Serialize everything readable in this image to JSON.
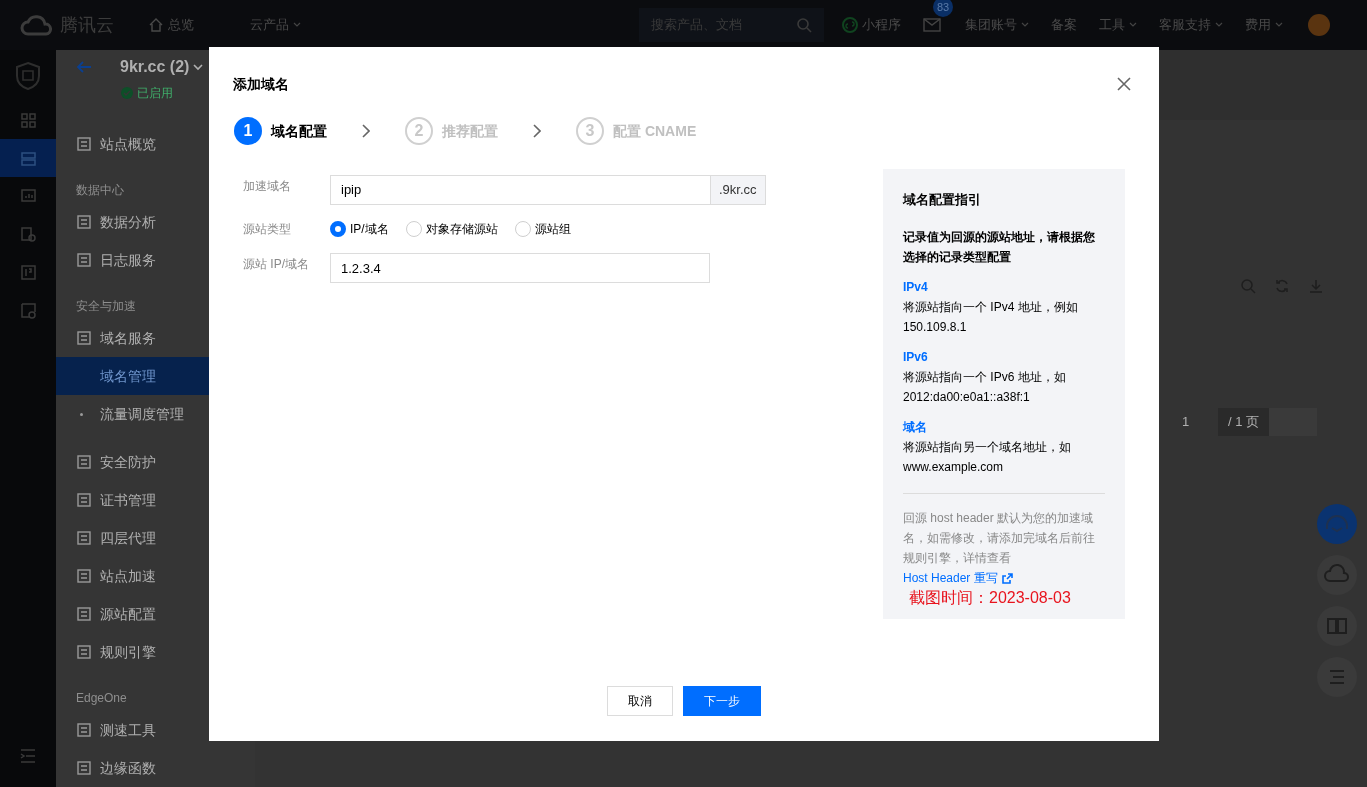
{
  "top_bar": {
    "brand": "腾讯云",
    "nav": [
      {
        "label": "总览",
        "kind": "home"
      },
      {
        "label": "云产品",
        "kind": "dropdown"
      }
    ],
    "search": {
      "placeholder": "搜索产品、文档"
    },
    "right": [
      {
        "label": "小程序",
        "kind": "miniapp"
      },
      {
        "label": "83",
        "kind": "mail"
      },
      {
        "label": "集团账号",
        "kind": "dropdown"
      },
      {
        "label": "备案",
        "kind": "plain"
      },
      {
        "label": "工具",
        "kind": "dropdown"
      },
      {
        "label": "客服支持",
        "kind": "dropdown"
      },
      {
        "label": "费用",
        "kind": "dropdown"
      }
    ]
  },
  "icon_rail": {
    "items": [
      {
        "selected": false
      },
      {
        "selected": true
      },
      {
        "selected": false
      },
      {
        "selected": false
      },
      {
        "selected": false
      },
      {
        "selected": false
      }
    ]
  },
  "sidebar": {
    "site": "9kr.cc (2)",
    "status": "已启用",
    "items": [
      {
        "kind": "item",
        "label": "站点概览",
        "selected": false
      },
      {
        "kind": "section",
        "label": "数据中心"
      },
      {
        "kind": "item",
        "label": "数据分析",
        "selected": false
      },
      {
        "kind": "item",
        "label": "日志服务",
        "selected": false
      },
      {
        "kind": "section",
        "label": "安全与加速"
      },
      {
        "kind": "item",
        "label": "域名服务",
        "selected": false,
        "children": [
          {
            "label": "域名管理",
            "selected": true
          },
          {
            "label": "流量调度管理",
            "selected": false
          }
        ]
      },
      {
        "kind": "item",
        "label": "安全防护",
        "selected": false
      },
      {
        "kind": "item",
        "label": "证书管理",
        "selected": false
      },
      {
        "kind": "item",
        "label": "四层代理",
        "selected": false
      },
      {
        "kind": "item",
        "label": "站点加速",
        "selected": false
      },
      {
        "kind": "item",
        "label": "源站配置",
        "selected": false
      },
      {
        "kind": "item",
        "label": "规则引擎",
        "selected": false
      },
      {
        "kind": "section",
        "label": "EdgeOne"
      },
      {
        "kind": "item",
        "label": "测速工具",
        "selected": false
      },
      {
        "kind": "item",
        "label": "边缘函数",
        "selected": false
      }
    ]
  },
  "background_page": {
    "pagination": {
      "page": "1",
      "total": "/ 1 页"
    }
  },
  "dialog": {
    "title": "添加域名",
    "steps": [
      {
        "number": "1",
        "label": "域名配置",
        "selected": true
      },
      {
        "number": "2",
        "label": "推荐配置",
        "selected": false
      },
      {
        "number": "3",
        "label": "配置 CNAME",
        "selected": false
      }
    ],
    "form": {
      "domain": {
        "label": "加速域名",
        "value": "ipip",
        "suffix": ".9kr.cc"
      },
      "origin_type": {
        "label": "源站类型",
        "options": [
          {
            "label": "IP/域名",
            "selected": true
          },
          {
            "label": "对象存储源站",
            "selected": false
          },
          {
            "label": "源站组",
            "selected": false
          }
        ]
      },
      "origin": {
        "label": "源站 IP/域名",
        "value": "1.2.3.4"
      }
    },
    "guide": {
      "title": "域名配置指引",
      "intro": "记录值为回源的源站地址，请根据您选择的记录类型配置",
      "entries": [
        {
          "heading": "IPv4",
          "text": "将源站指向一个 IPv4 地址，例如 150.109.8.1"
        },
        {
          "heading": "IPv6",
          "text": "将源站指向一个 IPv6 地址，如 2012:da00:e0a1::a38f:1"
        },
        {
          "heading": "域名",
          "text": "将源站指向另一个域名地址，如 www.example.com"
        }
      ],
      "note": "回源 host header 默认为您的加速域名，如需修改，请添加完域名后前往规则引擎，详情查看",
      "note_link": "Host Header 重写"
    },
    "annotation": "截图时间：2023-08-03",
    "buttons": [
      {
        "label": "取消",
        "kind": "secondary"
      },
      {
        "label": "下一步",
        "kind": "primary"
      }
    ]
  }
}
